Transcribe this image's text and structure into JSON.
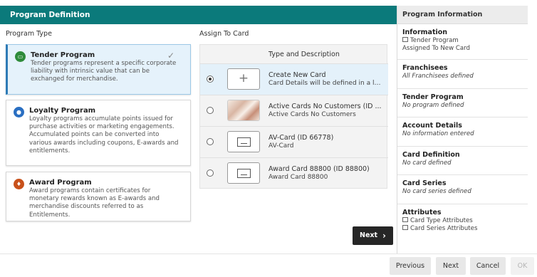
{
  "header": {
    "title": "Program Definition"
  },
  "program_type": {
    "heading": "Program Type",
    "programs": [
      {
        "title": "Tender Program",
        "description": "Tender programs represent a specific corporate liability with intrinsic value that can be exchanged for merchandise.",
        "icon": "tender-icon",
        "color": "#2e8b3a",
        "selected": true
      },
      {
        "title": "Loyalty Program",
        "description": "Loyalty programs accumulate points issued for purchase activities or marketing engagements. Accumulated points can be converted into various awards including coupons, E-awards and entitlements.",
        "icon": "person-icon",
        "color": "#2a6fc2",
        "selected": false
      },
      {
        "title": "Award Program",
        "description": "Award programs contain certificates for monetary rewards known as E-awards and merchandise discounts referred to as Entitlements.",
        "icon": "award-icon",
        "color": "#c8511b",
        "selected": false
      }
    ]
  },
  "assign": {
    "heading": "Assign To Card",
    "column_header": "Type and Description",
    "rows": [
      {
        "title": "Create New Card",
        "desc": "Card Details will be defined in a lat...",
        "selected": true,
        "thumb": "plus-icon"
      },
      {
        "title": "Active Cards No Customers (ID ...",
        "desc": "Active Cards No Customers",
        "selected": false,
        "thumb": "photo-card"
      },
      {
        "title": "AV-Card (ID 66778)",
        "desc": "AV-Card",
        "selected": false,
        "thumb": "card-icon"
      },
      {
        "title": "Award Card 88800 (ID 88800)",
        "desc": "Award Card 88800",
        "selected": false,
        "thumb": "card-icon"
      }
    ]
  },
  "next_inline": {
    "label": "Next",
    "icon": "chevron-right-icon"
  },
  "side": {
    "title": "Program Information",
    "sections": [
      {
        "title": "Information",
        "values": [
          "Tender Program",
          "Assigned To New Card"
        ]
      },
      {
        "title": "Franchisees",
        "values": [
          "All Franchisees defined"
        ]
      },
      {
        "title": "Tender Program",
        "values": [
          "No program defined"
        ]
      },
      {
        "title": "Account Details",
        "values": [
          "No information entered"
        ]
      },
      {
        "title": "Card Definition",
        "values": [
          "No card defined"
        ]
      },
      {
        "title": "Card Series",
        "values": [
          "No card series defined"
        ]
      },
      {
        "title": "Attributes",
        "values": [
          "Card Type Attributes",
          "Card Series Attributes"
        ]
      }
    ]
  },
  "footer": {
    "previous": "Previous",
    "next": "Next",
    "cancel": "Cancel",
    "ok": "OK"
  }
}
